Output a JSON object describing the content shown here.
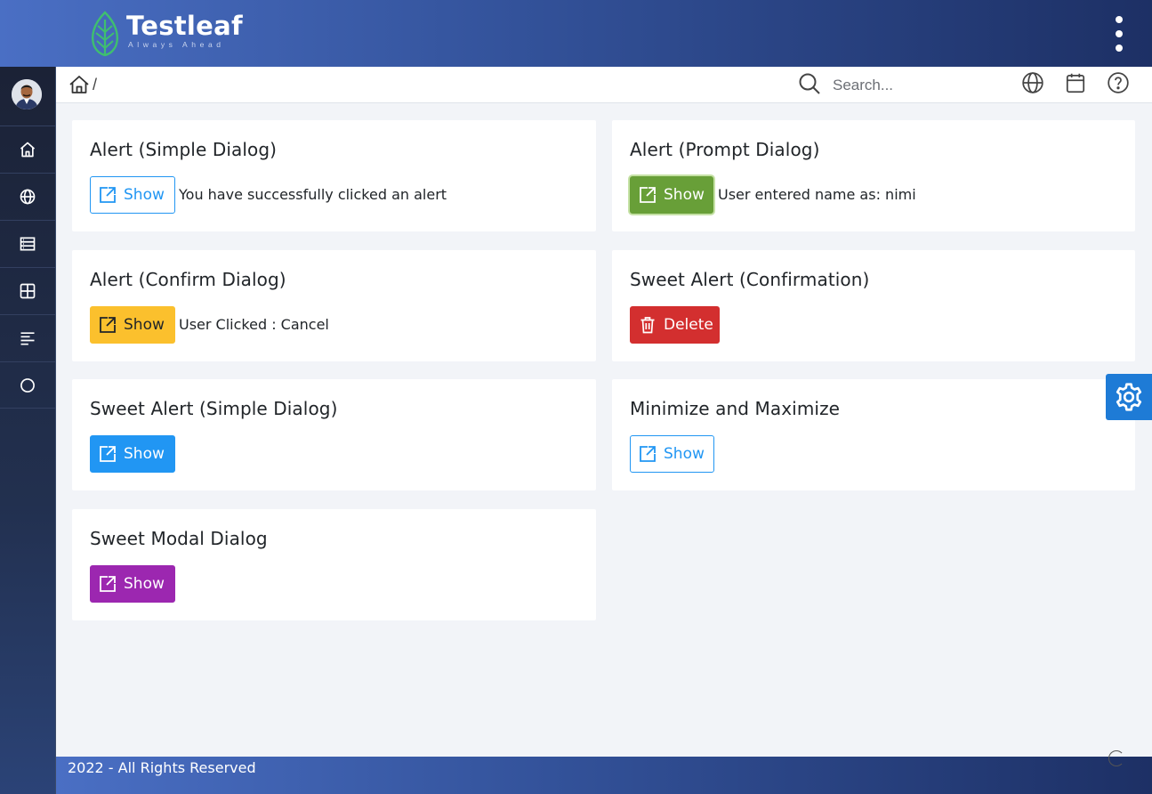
{
  "brand": {
    "name": "Testleaf",
    "tagline": "Always Ahead",
    "leaf_color": "#3fbf6f"
  },
  "topbar": {
    "menu_icon": "kebab-menu-icon"
  },
  "sidebar": {
    "items": [
      {
        "icon": "home-icon"
      },
      {
        "icon": "globe-icon"
      },
      {
        "icon": "server-list-icon"
      },
      {
        "icon": "grid-icon"
      },
      {
        "icon": "align-left-icon"
      },
      {
        "icon": "circle-icon"
      }
    ]
  },
  "breadcrumb": {
    "separator": "/"
  },
  "search": {
    "placeholder": "Search...",
    "value": ""
  },
  "header_icons": [
    "globe-icon",
    "calendar-icon",
    "help-icon"
  ],
  "cards": [
    {
      "title": "Alert (Simple Dialog)",
      "button": "Show",
      "result": "You have successfully clicked an alert",
      "style": "outline"
    },
    {
      "title": "Alert (Prompt Dialog)",
      "button": "Show",
      "result": "User entered name as: nimi",
      "style": "green"
    },
    {
      "title": "Alert (Confirm Dialog)",
      "button": "Show",
      "result": "User Clicked : Cancel",
      "style": "yellow"
    },
    {
      "title": "Sweet Alert (Confirmation)",
      "button": "Delete",
      "result": "",
      "style": "red"
    },
    {
      "title": "Sweet Alert (Simple Dialog)",
      "button": "Show",
      "result": "",
      "style": "blue"
    },
    {
      "title": "Minimize and Maximize",
      "button": "Show",
      "result": "",
      "style": "outline"
    },
    {
      "title": "Sweet Modal Dialog",
      "button": "Show",
      "result": "",
      "style": "purple"
    }
  ],
  "footer": {
    "text": "2022 - All Rights Reserved"
  },
  "colors": {
    "primary": "#2196f3",
    "success": "#689f38",
    "warning": "#fbc02d",
    "danger": "#d32f2f",
    "help": "#9c27b0"
  }
}
